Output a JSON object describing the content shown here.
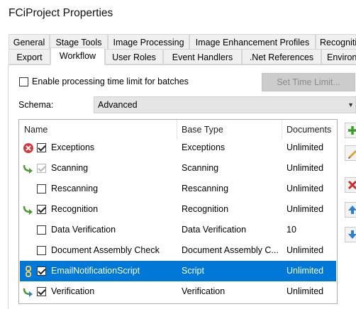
{
  "window": {
    "title": "FCiProject Properties"
  },
  "tabs_row1": [
    {
      "label": "General"
    },
    {
      "label": "Stage Tools"
    },
    {
      "label": "Image Processing"
    },
    {
      "label": "Image Enhancement Profiles"
    },
    {
      "label": "Recogniti"
    }
  ],
  "tabs_row2": [
    {
      "label": "Export"
    },
    {
      "label": "Workflow",
      "active": true
    },
    {
      "label": "User Roles"
    },
    {
      "label": "Event Handlers"
    },
    {
      "label": ".Net References"
    },
    {
      "label": "Environ"
    }
  ],
  "time_limit": {
    "label": "Enable processing time limit for batches",
    "checked": false,
    "button": "Set Time Limit..."
  },
  "schema": {
    "label": "Schema:",
    "value": "Advanced"
  },
  "columns": {
    "name": "Name",
    "base_type": "Base Type",
    "documents": "Documents"
  },
  "rows": [
    {
      "icon": "error-icon",
      "checked": true,
      "disabled": false,
      "name": "Exceptions",
      "base_type": "Exceptions",
      "documents": "Unlimited"
    },
    {
      "icon": "route-arrow-icon",
      "checked": true,
      "disabled": true,
      "name": "Scanning",
      "base_type": "Scanning",
      "documents": "Unlimited"
    },
    {
      "icon": "",
      "checked": false,
      "disabled": false,
      "name": "Rescanning",
      "base_type": "Rescanning",
      "documents": "Unlimited"
    },
    {
      "icon": "route-arrow-icon",
      "checked": true,
      "disabled": false,
      "name": "Recognition",
      "base_type": "Recognition",
      "documents": "Unlimited"
    },
    {
      "icon": "",
      "checked": false,
      "disabled": false,
      "name": "Data Verification",
      "base_type": "Data Verification",
      "documents": "10"
    },
    {
      "icon": "",
      "checked": false,
      "disabled": false,
      "name": "Document Assembly Check",
      "base_type": "Document Assembly C...",
      "documents": "Unlimited"
    },
    {
      "icon": "link-icon",
      "checked": true,
      "disabled": false,
      "selected": true,
      "name": "EmailNotificationScript",
      "base_type": "Script",
      "documents": "Unlimited"
    },
    {
      "icon": "route-arrow-icon-blue",
      "checked": true,
      "disabled": false,
      "name": "Verification",
      "base_type": "Verification",
      "documents": "Unlimited"
    }
  ],
  "side_buttons": [
    {
      "icon": "add-icon"
    },
    {
      "icon": "edit-icon"
    },
    {
      "icon": "delete-icon"
    },
    {
      "icon": "move-up-icon"
    },
    {
      "icon": "move-down-icon"
    }
  ],
  "colors": {
    "selection": "#0078d7",
    "add": "#3a9a2a",
    "delete": "#d02b2b",
    "arrow": "#4f9a2e",
    "updown": "#2f7fd0"
  }
}
